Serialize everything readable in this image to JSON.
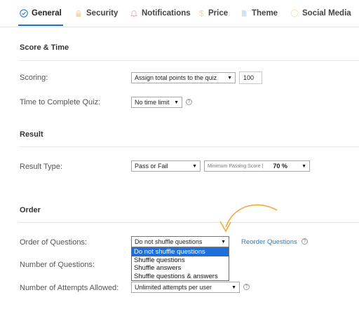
{
  "tabs": [
    {
      "label": "General",
      "icon": "check-circle-icon",
      "color": "#2a7bc9",
      "active": true
    },
    {
      "label": "Security",
      "icon": "lock-icon",
      "color": "#f5c98a"
    },
    {
      "label": "Notifications",
      "icon": "bell-icon",
      "color": "#f3b6b6"
    },
    {
      "label": "Price",
      "icon": "dollar-icon",
      "color": "#f5d7a0"
    },
    {
      "label": "Theme",
      "icon": "document-icon",
      "color": "#b9d6f2"
    },
    {
      "label": "Social Media",
      "icon": "globe-icon",
      "color": "#f5e6c0"
    }
  ],
  "score_time": {
    "title": "Score & Time",
    "scoring_label": "Scoring:",
    "scoring_value": "Assign total points to the quiz",
    "points_value": "100",
    "time_label": "Time to Complete Quiz:",
    "time_value": "No time limit"
  },
  "result": {
    "title": "Result",
    "type_label": "Result Type:",
    "type_value": "Pass or Fail",
    "min_score_label": "Minimum Passing Score |",
    "min_score_value": "70 %"
  },
  "order": {
    "title": "Order",
    "questions_label": "Order of Questions:",
    "questions_value": "Do not shuffle questions",
    "reorder_link": "Reorder Questions",
    "number_label": "Number of Questions:",
    "attempts_label": "Number of Attempts Allowed:",
    "attempts_value": "Unlimited attempts per user",
    "dropdown_options": [
      "Do not shuffle questions",
      "Shuffle questions",
      "Shuffle answers",
      "Shuffle questions & answers"
    ]
  },
  "colors": {
    "accent": "#1a73c9",
    "annotation_arrow": "#f2a93b",
    "dropdown_highlight": "#1e6fd9"
  }
}
